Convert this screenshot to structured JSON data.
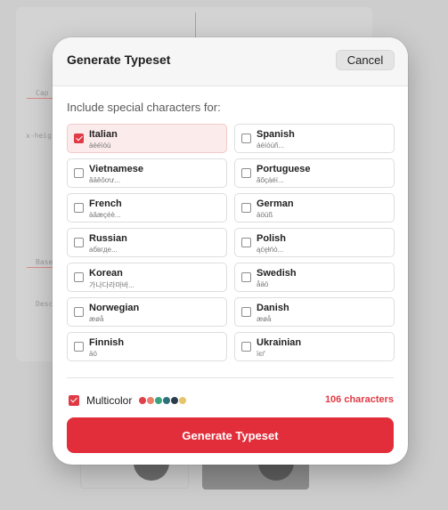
{
  "background": {
    "labels": [
      "Cap",
      "x-heig",
      "Base",
      "Desc"
    ]
  },
  "modal": {
    "title": "Generate Typeset",
    "cancel_label": "Cancel",
    "section_label": "Include special characters for:",
    "languages": [
      {
        "name": "Italian",
        "sample": "àèéìòù",
        "checked": true
      },
      {
        "name": "Spanish",
        "sample": "áéíóúñ...",
        "checked": false
      },
      {
        "name": "Vietnamese",
        "sample": "ăâêôơư...",
        "checked": false
      },
      {
        "name": "Portuguese",
        "sample": "ãõçáéí...",
        "checked": false
      },
      {
        "name": "French",
        "sample": "àâæçéè...",
        "checked": false
      },
      {
        "name": "German",
        "sample": "äöüß",
        "checked": false
      },
      {
        "name": "Russian",
        "sample": "абвгде...",
        "checked": false
      },
      {
        "name": "Polish",
        "sample": "ąćęłńó...",
        "checked": false
      },
      {
        "name": "Korean",
        "sample": "가나다라마바...",
        "checked": false
      },
      {
        "name": "Swedish",
        "sample": "åäö",
        "checked": false
      },
      {
        "name": "Norwegian",
        "sample": "æøå",
        "checked": false
      },
      {
        "name": "Danish",
        "sample": "æøå",
        "checked": false
      },
      {
        "name": "Finnish",
        "sample": "äö",
        "checked": false
      },
      {
        "name": "Ukrainian",
        "sample": "їєґ",
        "checked": false
      }
    ],
    "multicolor": {
      "label": "Multicolor",
      "checked": true,
      "swatches": [
        "#e0404a",
        "#e9806a",
        "#3aa37e",
        "#2e6f7a",
        "#2d3b4a",
        "#e5c46a"
      ]
    },
    "char_count": "106 characters",
    "generate_label": "Generate Typeset"
  },
  "colors": {
    "accent": "#e22d3a"
  }
}
